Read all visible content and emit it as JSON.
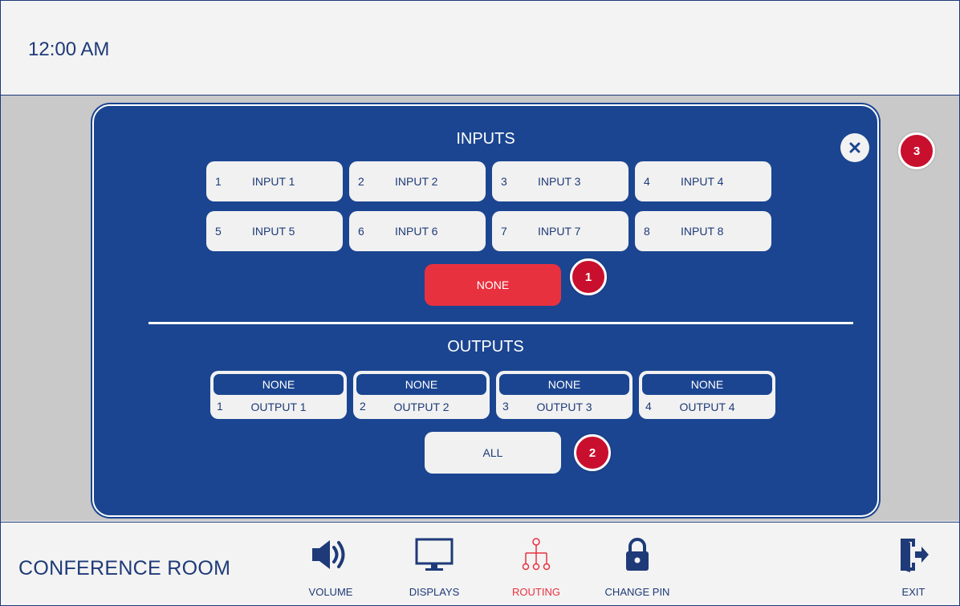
{
  "header": {
    "time": "12:00 AM"
  },
  "routing": {
    "inputs_title": "INPUTS",
    "outputs_title": "OUTPUTS",
    "close_icon": "close-icon",
    "inputs": [
      {
        "num": "1",
        "label": "INPUT 1"
      },
      {
        "num": "2",
        "label": "INPUT 2"
      },
      {
        "num": "3",
        "label": "INPUT 3"
      },
      {
        "num": "4",
        "label": "INPUT 4"
      },
      {
        "num": "5",
        "label": "INPUT 5"
      },
      {
        "num": "6",
        "label": "INPUT 6"
      },
      {
        "num": "7",
        "label": "INPUT 7"
      },
      {
        "num": "8",
        "label": "INPUT 8"
      }
    ],
    "none_label": "NONE",
    "outputs": [
      {
        "num": "1",
        "label": "OUTPUT 1",
        "route": "NONE"
      },
      {
        "num": "2",
        "label": "OUTPUT 2",
        "route": "NONE"
      },
      {
        "num": "3",
        "label": "OUTPUT 3",
        "route": "NONE"
      },
      {
        "num": "4",
        "label": "OUTPUT 4",
        "route": "NONE"
      }
    ],
    "all_label": "ALL"
  },
  "callouts": [
    "1",
    "2",
    "3"
  ],
  "footer": {
    "room": "CONFERENCE ROOM",
    "nav": [
      {
        "label": "VOLUME",
        "icon": "speaker-icon"
      },
      {
        "label": "DISPLAYS",
        "icon": "monitor-icon"
      },
      {
        "label": "ROUTING",
        "icon": "routing-icon",
        "active": true
      },
      {
        "label": "CHANGE PIN",
        "icon": "lock-icon"
      }
    ],
    "exit": {
      "label": "EXIT",
      "icon": "exit-icon"
    }
  },
  "colors": {
    "primary": "#1b4591",
    "accent": "#e8313f",
    "text": "#1e3a78",
    "callout": "#c8102e"
  }
}
